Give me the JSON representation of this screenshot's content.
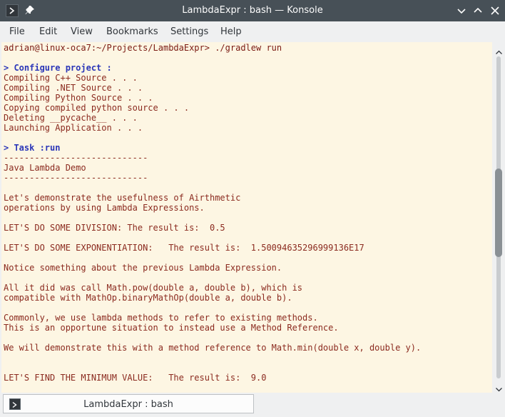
{
  "window": {
    "title": "LambdaExpr : bash — Konsole",
    "icons": [
      "konsole-app-icon",
      "pin-icon",
      "minimize-icon",
      "maximize-icon",
      "close-icon"
    ]
  },
  "menu": {
    "items": [
      "File",
      "Edit",
      "View",
      "Bookmarks",
      "Settings",
      "Help"
    ]
  },
  "terminal": {
    "lines": [
      {
        "text": "adrian@linux-oca7:~/Projects/LambdaExpr> ./gradlew run",
        "style": "prompt"
      },
      {
        "text": "",
        "style": "normal"
      },
      {
        "text": "> Configure project :",
        "style": "bold"
      },
      {
        "text": "Compiling C++ Source . . .",
        "style": "normal"
      },
      {
        "text": "Compiling .NET Source . . .",
        "style": "normal"
      },
      {
        "text": "Compiling Python Source . . .",
        "style": "normal"
      },
      {
        "text": "Copying compiled python source . . .",
        "style": "normal"
      },
      {
        "text": "Deleting __pycache__ . . .",
        "style": "normal"
      },
      {
        "text": "Launching Application . . .",
        "style": "normal"
      },
      {
        "text": "",
        "style": "normal"
      },
      {
        "text": "> Task :run",
        "style": "bold"
      },
      {
        "text": "----------------------------",
        "style": "normal"
      },
      {
        "text": "Java Lambda Demo",
        "style": "normal"
      },
      {
        "text": "----------------------------",
        "style": "normal"
      },
      {
        "text": "",
        "style": "normal"
      },
      {
        "text": "Let's demonstrate the usefulness of Airthmetic",
        "style": "normal"
      },
      {
        "text": "operations by using Lambda Expressions.",
        "style": "normal"
      },
      {
        "text": "",
        "style": "normal"
      },
      {
        "text": "LET'S DO SOME DIVISION: The result is:  0.5",
        "style": "normal"
      },
      {
        "text": "",
        "style": "normal"
      },
      {
        "text": "LET'S DO SOME EXPONENTIATION:   The result is:  1.50094635296999136E17",
        "style": "normal"
      },
      {
        "text": "",
        "style": "normal"
      },
      {
        "text": "Notice something about the previous Lambda Expression.",
        "style": "normal"
      },
      {
        "text": "",
        "style": "normal"
      },
      {
        "text": "All it did was call Math.pow(double a, double b), which is",
        "style": "normal"
      },
      {
        "text": "compatible with MathOp.binaryMathOp(double a, double b).",
        "style": "normal"
      },
      {
        "text": "",
        "style": "normal"
      },
      {
        "text": "Commonly, we use lambda methods to refer to existing methods.",
        "style": "normal"
      },
      {
        "text": "This is an opportune situation to instead use a Method Reference.",
        "style": "normal"
      },
      {
        "text": "",
        "style": "normal"
      },
      {
        "text": "We will demonstrate this with a method reference to Math.min(double x, double y).",
        "style": "normal"
      },
      {
        "text": "",
        "style": "normal"
      },
      {
        "text": "",
        "style": "normal"
      },
      {
        "text": "LET'S FIND THE MINIMUM VALUE:   The result is:  9.0",
        "style": "normal"
      }
    ]
  },
  "tabs": [
    {
      "label": "LambdaExpr : bash"
    }
  ],
  "colors": {
    "titlebar": "#475057",
    "terminal_bg": "#fdf6e3",
    "terminal_text": "#8b2a1f",
    "terminal_bold": "#2b36b8"
  }
}
